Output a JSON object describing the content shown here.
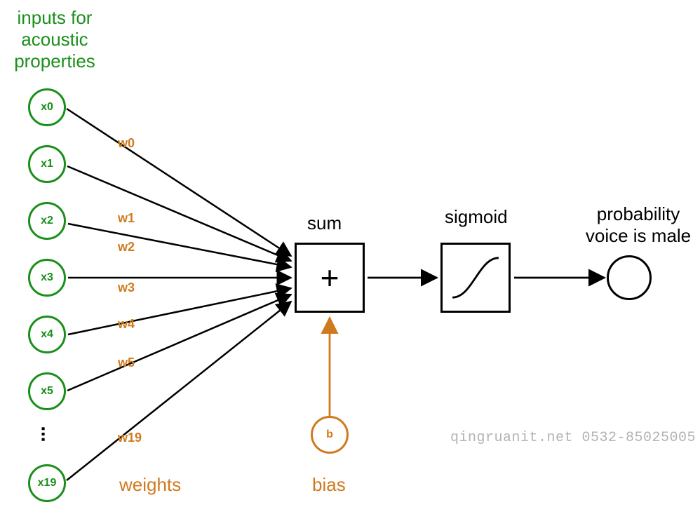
{
  "title": "inputs for\nacoustic\nproperties",
  "inputs": [
    "x0",
    "x1",
    "x2",
    "x3",
    "x4",
    "x5",
    "x19"
  ],
  "weights": [
    "w0",
    "w1",
    "w2",
    "w3",
    "w4",
    "w5",
    "w19"
  ],
  "sum_label": "sum",
  "sum_symbol": "+",
  "sigmoid_label": "sigmoid",
  "output_label": "probability\nvoice is male",
  "bias_symbol": "b",
  "weights_word": "weights",
  "bias_word": "bias",
  "watermark": "qingruanit.net 0532-85025005"
}
